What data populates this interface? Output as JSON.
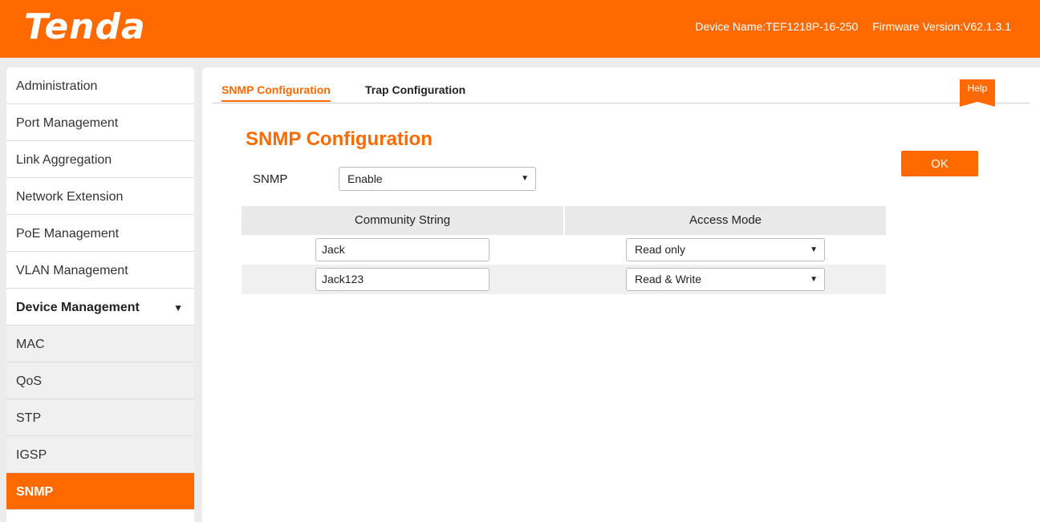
{
  "header": {
    "logo": "Tenda",
    "device_name": "Device Name:TEF1218P-16-250",
    "firmware_version": "Firmware Version:V62.1.3.1"
  },
  "sidebar": {
    "items": [
      {
        "label": "Administration"
      },
      {
        "label": "Port Management"
      },
      {
        "label": "Link Aggregation"
      },
      {
        "label": "Network Extension"
      },
      {
        "label": "PoE Management"
      },
      {
        "label": "VLAN Management"
      },
      {
        "label": "Device Management",
        "expanded": true
      },
      {
        "label": "MAC"
      },
      {
        "label": "QoS"
      },
      {
        "label": "STP"
      },
      {
        "label": "IGSP"
      },
      {
        "label": "SNMP",
        "active": true
      }
    ],
    "expand_icon": "triangle-down"
  },
  "tabs": [
    {
      "label": "SNMP Configuration",
      "active": true
    },
    {
      "label": "Trap Configuration",
      "active": false
    }
  ],
  "help_label": "Help",
  "section_title": "SNMP Configuration",
  "ok_label": "OK",
  "snmp": {
    "label": "SNMP",
    "value": "Enable"
  },
  "table": {
    "headers": [
      "Community String",
      "Access Mode"
    ],
    "rows": [
      {
        "community": "Jack",
        "access": "Read only"
      },
      {
        "community": "Jack123",
        "access": "Read & Write"
      }
    ]
  },
  "colors": {
    "accent": "#ff6a00"
  }
}
